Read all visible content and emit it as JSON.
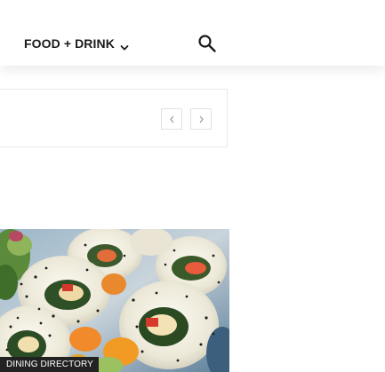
{
  "header": {
    "nav_item_label": "FOOD + DRINK",
    "search_label": "search"
  },
  "slider": {
    "prev_icon": "chevron-left-icon",
    "next_icon": "chevron-right-icon"
  },
  "featured": {
    "category": "DINING DIRECTORY"
  },
  "colors": {
    "text": "#1b1b1b",
    "tag_background": "#222222",
    "tag_text": "#ffffff",
    "border": "#e1e1e1"
  }
}
